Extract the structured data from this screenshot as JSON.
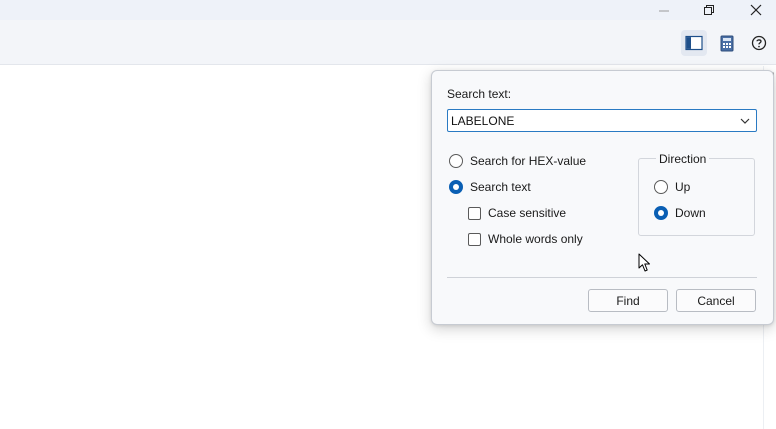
{
  "window": {
    "controls": {
      "minimize_icon": "minimize-icon",
      "restore_icon": "restore-icon",
      "close_icon": "close-icon"
    }
  },
  "toolbar": {
    "buttons": [
      {
        "name": "panel-toggle-icon",
        "active": true
      },
      {
        "name": "calculator-icon",
        "active": false
      },
      {
        "name": "help-icon",
        "active": false
      }
    ]
  },
  "find_dialog": {
    "search_label": "Search text:",
    "search_value": "LABELONE",
    "options": {
      "hex_label": "Search for HEX-value",
      "text_label": "Search text",
      "selected": "text",
      "case_sensitive_label": "Case sensitive",
      "case_sensitive": false,
      "whole_words_label": "Whole words only",
      "whole_words": false
    },
    "direction": {
      "title": "Direction",
      "up_label": "Up",
      "down_label": "Down",
      "selected": "down"
    },
    "buttons": {
      "find_label": "Find",
      "cancel_label": "Cancel"
    }
  },
  "colors": {
    "accent": "#0a5fb4",
    "titlebar": "#eef2f9",
    "toolbar": "#f3f5f9",
    "dialog_bg": "#f8f9fb"
  }
}
